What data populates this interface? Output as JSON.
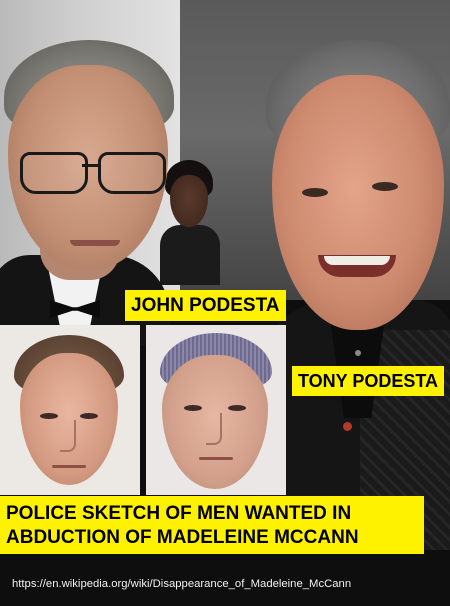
{
  "labels": {
    "john": "JOHN PODESTA",
    "tony": "TONY PODESTA",
    "police_line1": "POLICE SKETCH OF MEN WANTED IN",
    "police_line2": "ABDUCTION OF MADELEINE MCCANN"
  },
  "source_url": "https://en.wikipedia.org/wiki/Disappearance_of_Madeleine_McCann",
  "colors": {
    "label_background": "#fff200",
    "label_text": "#000000",
    "url_text": "#f2f2f2",
    "background": "#0d0d0d"
  }
}
